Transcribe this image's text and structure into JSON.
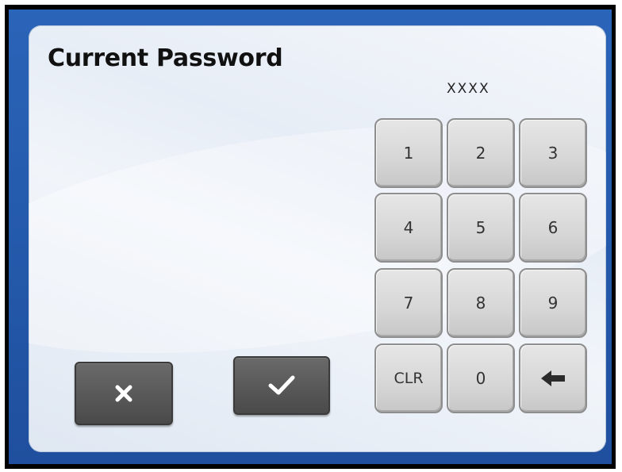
{
  "dialog": {
    "title": "Current Password",
    "masked_value": "XXXX"
  },
  "keypad": {
    "keys": [
      {
        "label": "1"
      },
      {
        "label": "2"
      },
      {
        "label": "3"
      },
      {
        "label": "4"
      },
      {
        "label": "5"
      },
      {
        "label": "6"
      },
      {
        "label": "7"
      },
      {
        "label": "8"
      },
      {
        "label": "9"
      },
      {
        "label": "CLR"
      },
      {
        "label": "0"
      },
      {
        "icon": "backspace-arrow-icon"
      }
    ]
  },
  "actions": {
    "cancel_icon": "close-icon",
    "confirm_icon": "checkmark-icon"
  },
  "colors": {
    "frame": "#000000",
    "border_blue": "#2a64b8",
    "key_face": "#d6d6d6",
    "action_button": "#585858"
  }
}
